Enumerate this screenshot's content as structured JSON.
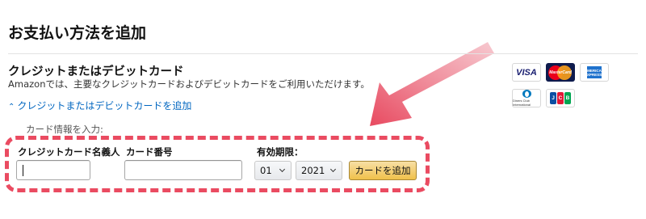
{
  "page": {
    "title": "お支払い方法を追加"
  },
  "section": {
    "heading": "クレジットまたはデビットカード",
    "description": "Amazonでは、主要なクレジットカードおよびデビットカードをご利用いただけます。",
    "add_link_label": "クレジットまたはデビットカードを追加"
  },
  "form": {
    "card_info_label": "カード情報を入力:",
    "name_label": "クレジットカード名義人",
    "name_value": "",
    "number_label": "カード番号",
    "number_value": "",
    "expiry_label": "有効期限：",
    "month_selected": "01",
    "year_selected": "2021",
    "submit_label": "カードを追加"
  },
  "card_logos": [
    {
      "name": "visa-logo",
      "text": "VISA"
    },
    {
      "name": "mastercard-logo",
      "text": "MasterCard"
    },
    {
      "name": "amex-logo",
      "text": "AMERICAN EXPRESS"
    },
    {
      "name": "diners-logo",
      "text": "Diners Club International"
    },
    {
      "name": "jcb-logo",
      "text": "JCB"
    }
  ],
  "colors": {
    "link": "#0066c0",
    "annotation": "#ea4b61",
    "button_top": "#f7dfa5",
    "button_bottom": "#f0c14b"
  }
}
